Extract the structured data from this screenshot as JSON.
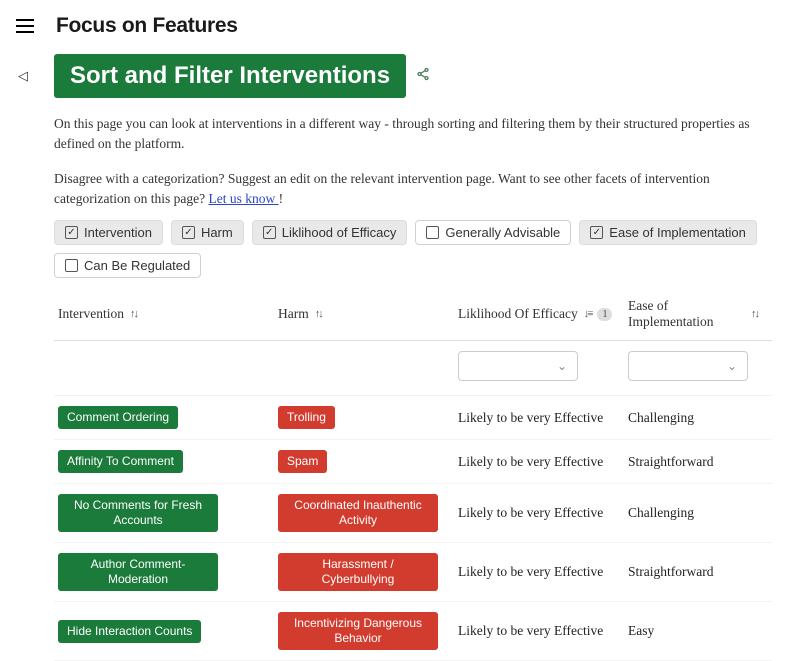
{
  "brand": "Focus on Features",
  "title": "Sort and Filter Interventions",
  "intro1": "On this page you can look at interventions in a different way - through sorting and filtering them by their structured properties as defined on the platform.",
  "intro2_a": "Disagree with a categorization? Suggest an edit on the relevant intervention page. Want to see other facets of intervention categorization on this page? ",
  "intro2_link": "Let us know ",
  "intro2_b": "!",
  "filters": [
    {
      "label": "Intervention",
      "on": true
    },
    {
      "label": "Harm",
      "on": true
    },
    {
      "label": "Liklihood of Efficacy",
      "on": true
    },
    {
      "label": "Generally Advisable",
      "on": false
    },
    {
      "label": "Ease of Implementation",
      "on": true
    },
    {
      "label": "Can Be Regulated",
      "on": false
    }
  ],
  "columns": {
    "c0": "Intervention",
    "c1": "Harm",
    "c2": "Liklihood Of Efficacy",
    "c2_badge": "1",
    "c3": "Ease of Implementation"
  },
  "rows": [
    {
      "intervention": "Comment Ordering",
      "harm": "Trolling",
      "efficacy": "Likely to be very Effective",
      "ease": "Challenging"
    },
    {
      "intervention": "Affinity To Comment",
      "harm": "Spam",
      "efficacy": "Likely to be very Effective",
      "ease": "Straightforward"
    },
    {
      "intervention": "No Comments for Fresh Accounts",
      "harm": "Coordinated Inauthentic Activity",
      "efficacy": "Likely to be very Effective",
      "ease": "Challenging"
    },
    {
      "intervention": "Author Comment-Moderation",
      "harm": "Harassment / Cyberbullying",
      "efficacy": "Likely to be very Effective",
      "ease": "Straightforward"
    },
    {
      "intervention": "Hide Interaction Counts",
      "harm": "Incentivizing Dangerous Behavior",
      "efficacy": "Likely to be very Effective",
      "ease": "Easy"
    }
  ]
}
